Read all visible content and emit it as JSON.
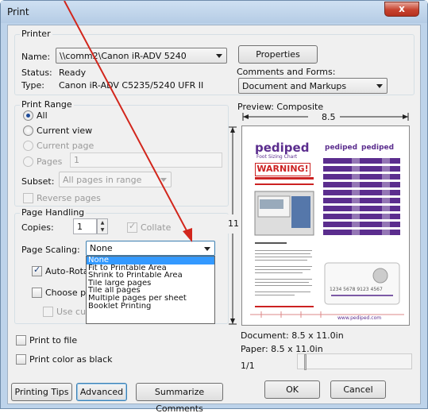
{
  "window": {
    "title": "Print",
    "close_label": "x"
  },
  "printer": {
    "group_label": "Printer",
    "name_label": "Name:",
    "name_value": "\\\\comm2\\Canon iR-ADV 5240",
    "properties_label": "Properties",
    "status_label": "Status:",
    "status_value": "Ready",
    "type_label": "Type:",
    "type_value": "Canon iR-ADV C5235/5240 UFR II",
    "comments_label": "Comments and Forms:",
    "comments_value": "Document and Markups"
  },
  "range": {
    "group_label": "Print Range",
    "all": "All",
    "current_view": "Current view",
    "current_page": "Current page",
    "pages": "Pages",
    "pages_value": "1",
    "subset_label": "Subset:",
    "subset_value": "All pages in range",
    "reverse": "Reverse pages"
  },
  "handling": {
    "group_label": "Page Handling",
    "copies_label": "Copies:",
    "copies_value": "1",
    "collate": "Collate",
    "scaling_label": "Page Scaling:",
    "scaling_value": "None",
    "auto_rotate": "Auto-Rotate",
    "choose_paper": "Choose pape",
    "use_custom": "Use custo"
  },
  "scaling_options": [
    "None",
    "Fit to Printable Area",
    "Shrink to Printable Area",
    "Tile large pages",
    "Tile all pages",
    "Multiple pages per sheet",
    "Booklet Printing"
  ],
  "preview": {
    "label": "Preview: Composite",
    "width_label": "8.5",
    "height_label": "11",
    "document_size": "Document: 8.5 x 11.0in",
    "paper_size": "Paper: 8.5 x 11.0in",
    "page_indicator": "1/1",
    "brand": "pediped",
    "subtitle": "Foot Sizing Chart",
    "warning": "WARNING!",
    "footer_url": "www.pediped.com",
    "card_number": "1234 5678 9123 4567"
  },
  "options": {
    "print_to_file": "Print to file",
    "print_color_as_black": "Print color as black"
  },
  "buttons": {
    "printing_tips": "Printing Tips",
    "advanced": "Advanced",
    "summarize": "Summarize Comments",
    "ok": "OK",
    "cancel": "Cancel"
  },
  "colors": {
    "arrow": "#d2261c",
    "brand_purple": "#5b2d8e",
    "selection": "#3399ff"
  }
}
